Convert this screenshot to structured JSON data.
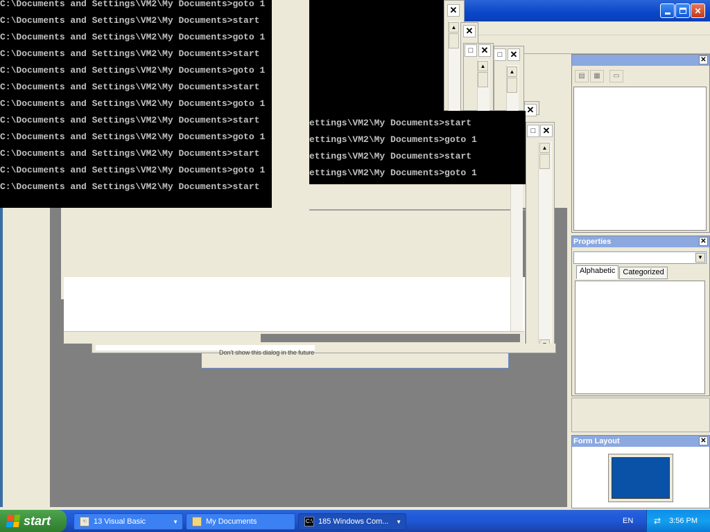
{
  "console": {
    "lines": [
      "C:\\Documents and Settings\\VM2\\My Documents>goto 1",
      "C:\\Documents and Settings\\VM2\\My Documents>start",
      "C:\\Documents and Settings\\VM2\\My Documents>goto 1",
      "C:\\Documents and Settings\\VM2\\My Documents>start",
      "C:\\Documents and Settings\\VM2\\My Documents>goto 1",
      "C:\\Documents and Settings\\VM2\\My Documents>start",
      "C:\\Documents and Settings\\VM2\\My Documents>goto 1",
      "C:\\Documents and Settings\\VM2\\My Documents>start",
      "C:\\Documents and Settings\\VM2\\My Documents>goto 1",
      "C:\\Documents and Settings\\VM2\\My Documents>start",
      "C:\\Documents and Settings\\VM2\\My Documents>goto 1",
      "C:\\Documents and Settings\\VM2\\My Documents>start"
    ],
    "second_lines": [
      "ettings\\VM2\\My Documents>start",
      "ettings\\VM2\\My Documents>goto 1",
      "ettings\\VM2\\My Documents>start",
      "ettings\\VM2\\My Documents>goto 1"
    ]
  },
  "glyphs": {
    "close": "✕",
    "maximize": "□",
    "scroll_up": "▲",
    "scroll_down": "▼",
    "dropdown": "▼"
  },
  "dialog": {
    "fragment_text": "Don't show this dialog in the future"
  },
  "panels": {
    "properties_title": "Properties",
    "tab_alphabetic": "Alphabetic",
    "tab_categorized": "Categorized",
    "form_layout_title": "Form Layout"
  },
  "taskbar": {
    "start_label": "start",
    "tasks": [
      {
        "label": "13 Visual Basic",
        "icon": "hand-icon"
      },
      {
        "label": "My Documents",
        "icon": "folder-icon"
      },
      {
        "label": "185 Windows Com...",
        "icon": "console-icon"
      }
    ],
    "language": "EN",
    "clock": "3:56 PM"
  },
  "colors": {
    "taskbar_blue": "#245edb",
    "start_green": "#3c8f3c",
    "desktop_gray": "#808080",
    "panel_title": "#8ba8e0",
    "form_layout_screen": "#0a52a8"
  }
}
